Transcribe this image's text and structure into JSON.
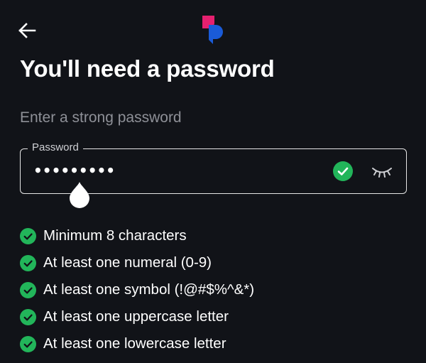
{
  "header": {
    "back_icon": "arrow-left-icon",
    "logo_icon": "brand-logo-icon",
    "logo_colors": {
      "pink": "#e5206f",
      "blue": "#1a5bd8"
    }
  },
  "page": {
    "title": "You'll need a password",
    "subtitle": "Enter a strong password"
  },
  "password_field": {
    "label": "Password",
    "value": "•••••••••",
    "valid_icon": "check-circle-icon",
    "visibility_icon": "eye-closed-icon"
  },
  "requirements": [
    {
      "text": "Minimum 8 characters",
      "met": true
    },
    {
      "text": "At least one numeral (0-9)",
      "met": true
    },
    {
      "text": "At least one symbol (!@#$%^&*)",
      "met": true
    },
    {
      "text": "At least one uppercase letter",
      "met": true
    },
    {
      "text": "At least one lowercase letter",
      "met": true
    }
  ],
  "colors": {
    "background": "#111318",
    "success": "#22b55a",
    "muted_text": "#8e9097"
  }
}
